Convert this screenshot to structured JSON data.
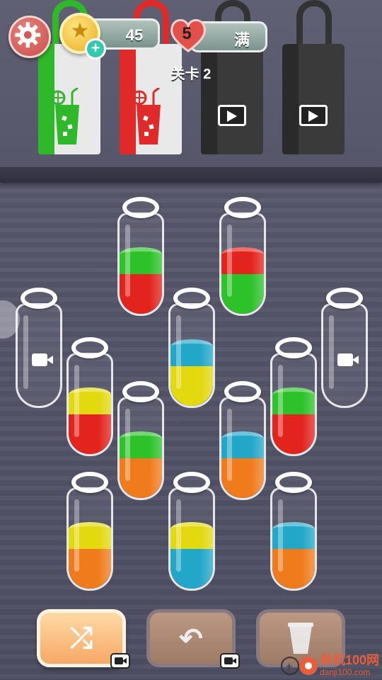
{
  "hud": {
    "coins": "45",
    "lives": "5",
    "lives_status": "满",
    "level": "关卡 2"
  },
  "colors": {
    "green": "#2dc22a",
    "red": "#e3231d",
    "blue": "#22a7c9",
    "yellow": "#e2d90f",
    "orange": "#f07b1c"
  },
  "bags": [
    {
      "color": "green",
      "locked": false
    },
    {
      "color": "red",
      "locked": false
    },
    {
      "color": "dark",
      "locked": true,
      "icon": "video-icon"
    },
    {
      "color": "dark",
      "locked": true,
      "icon": "video-icon"
    }
  ],
  "bottles": [
    {
      "id": "b1",
      "layers": [
        "red",
        "green"
      ],
      "locked": false
    },
    {
      "id": "b2",
      "layers": [
        "green",
        "red"
      ],
      "locked": false
    },
    {
      "id": "b3",
      "layers": [],
      "locked": true,
      "icon": "video-icon"
    },
    {
      "id": "b4",
      "layers": [
        "yellow",
        "blue"
      ],
      "locked": false
    },
    {
      "id": "b5",
      "layers": [],
      "locked": true,
      "icon": "video-icon"
    },
    {
      "id": "b6",
      "layers": [
        "red",
        "yellow"
      ],
      "locked": false
    },
    {
      "id": "b7",
      "layers": [
        "red",
        "green"
      ],
      "locked": false
    },
    {
      "id": "b8",
      "layers": [
        "orange",
        "green"
      ],
      "locked": false
    },
    {
      "id": "b9",
      "layers": [
        "orange",
        "blue"
      ],
      "locked": false
    },
    {
      "id": "b10",
      "layers": [
        "orange",
        "yellow"
      ],
      "locked": false
    },
    {
      "id": "b11",
      "layers": [
        "blue",
        "yellow"
      ],
      "locked": false
    },
    {
      "id": "b12",
      "layers": [
        "orange",
        "blue"
      ],
      "locked": false
    }
  ],
  "controls": {
    "shuffle_icon": "shuffle-icon",
    "undo_icon": "undo-icon",
    "cup_icon": "cup-icon"
  },
  "watermark": {
    "line1": "单机100网",
    "line2": "danji100.com"
  }
}
